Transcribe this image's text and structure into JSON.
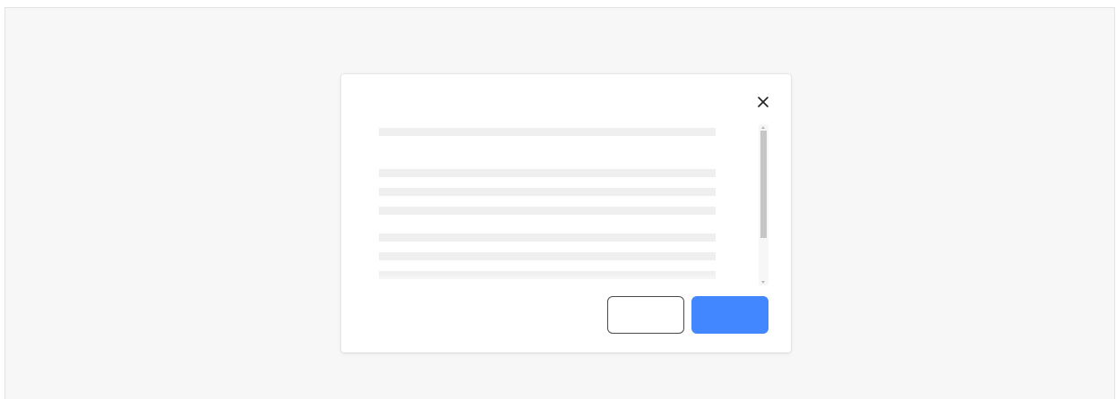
{
  "dialog": {
    "close_icon": "close-icon",
    "content_lines": 7,
    "buttons": {
      "secondary_label": "",
      "primary_label": ""
    }
  },
  "colors": {
    "backdrop": "#f7f7f7",
    "dialog_bg": "#ffffff",
    "skeleton": "#efefef",
    "scroll_thumb": "#c6c6c6",
    "primary": "#4287ff",
    "secondary_border": "#4a4a4a"
  }
}
